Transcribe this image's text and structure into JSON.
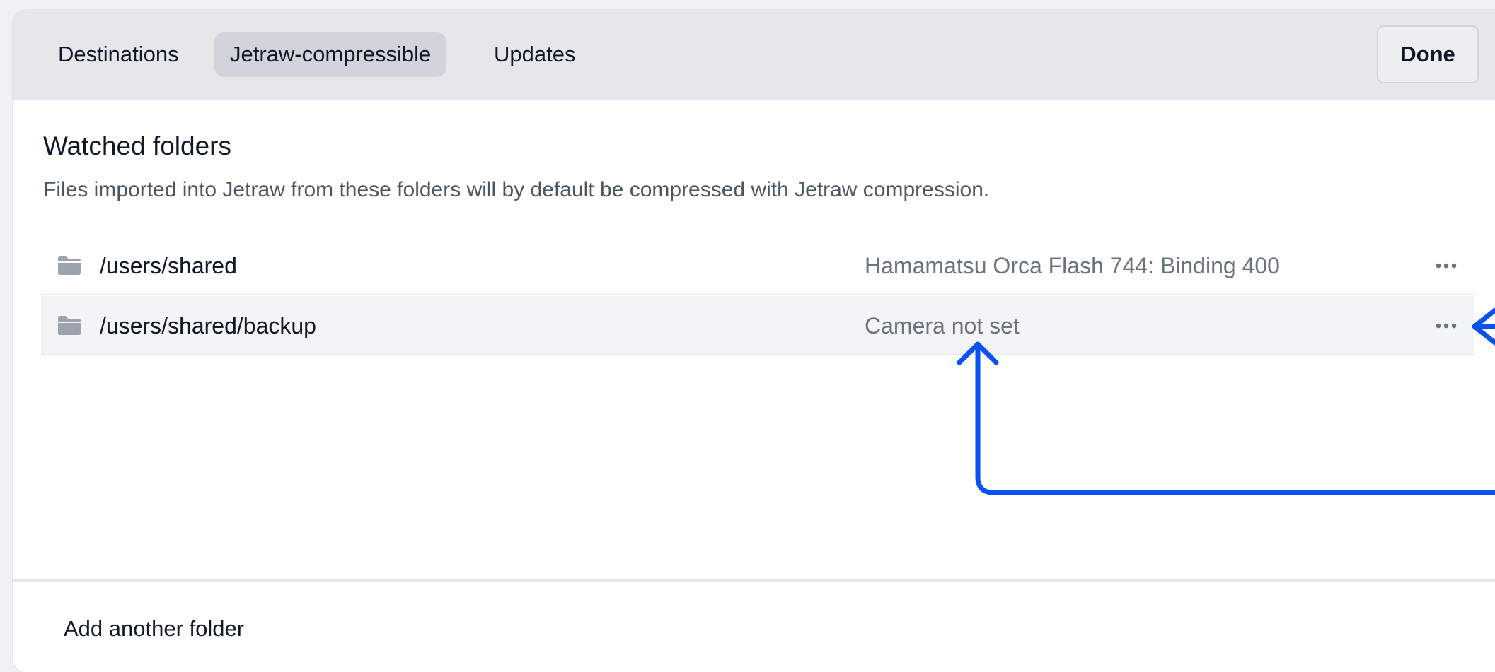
{
  "tabs": [
    {
      "label": "Destinations",
      "active": false
    },
    {
      "label": "Jetraw-compressible",
      "active": true
    },
    {
      "label": "Updates",
      "active": false
    }
  ],
  "done_label": "Done",
  "section": {
    "title": "Watched folders",
    "description": "Files imported into Jetraw from these folders will by default be compressed with Jetraw compression."
  },
  "folders": [
    {
      "path": "/users/shared",
      "camera": "Hamamatsu Orca Flash 744: Binding 400",
      "icon": "folder-icon",
      "menu_icon": "more-horizontal-icon"
    },
    {
      "path": "/users/shared/backup",
      "camera": "Camera not set",
      "icon": "folder-icon",
      "menu_icon": "more-horizontal-icon"
    }
  ],
  "add_folder_label": "Add another folder",
  "annotation": {
    "arrow_color": "#0a52f0"
  },
  "colors": {
    "tabbar_bg": "#e5e7eb",
    "active_tab_bg": "#d1d5db",
    "icon_gray": "#9ca3af",
    "text_primary": "#111827",
    "text_secondary": "#6b7280"
  }
}
